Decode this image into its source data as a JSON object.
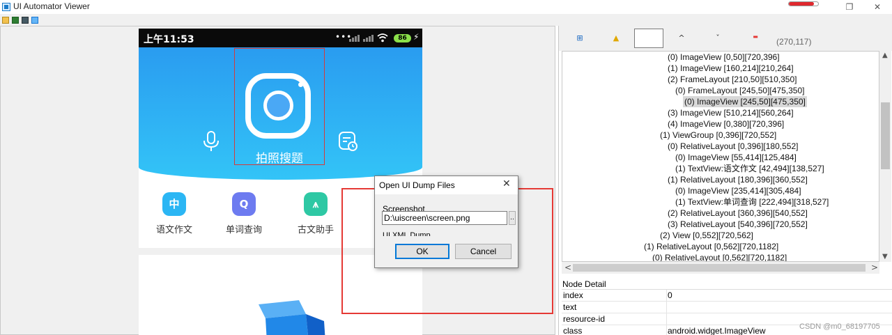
{
  "window": {
    "title": "UI Automator Viewer",
    "minimize_glyph": "—",
    "restore_glyph": "❐",
    "close_glyph": "✕",
    "progress_fraction": 0.85
  },
  "phone": {
    "status_time": "上午11:53",
    "status_dots": "•••",
    "battery": "86",
    "bolt": "⚡",
    "hero_label": "拍照搜题",
    "tools": [
      {
        "label": "语文作文",
        "glyph": "中",
        "color": "#2bb6f4"
      },
      {
        "label": "单词查询",
        "glyph": "Q",
        "color": "#6d7bf0"
      },
      {
        "label": "古文助手",
        "glyph": "⩚",
        "color": "#2ec8a4"
      }
    ]
  },
  "dialog": {
    "title": "Open UI Dump Files",
    "close": "✕",
    "screenshot_label": "Screenshot",
    "screenshot_path": "D:\\uiscreen\\screen.png",
    "browse_label": "..",
    "xml_label": "UI XML Dump",
    "ok_label": "OK",
    "cancel_label": "Cancel"
  },
  "right": {
    "toolbar": {
      "expand": "⊞",
      "warn": "▲",
      "up": "^",
      "down": "ˇ",
      "minus": "▬"
    },
    "coords": "(270,117)",
    "tree": [
      {
        "text": "(0) ImageView [0,50][720,396]",
        "selected": false
      },
      {
        "text": "(1) ImageView [160,214][210,264]",
        "selected": false
      },
      {
        "text": "(2) FrameLayout [210,50][510,350]",
        "selected": false
      },
      {
        "text": "(0) FrameLayout [245,50][475,350]",
        "selected": false
      },
      {
        "text": "(0) ImageView [245,50][475,350]",
        "selected": true
      },
      {
        "text": "(3) ImageView [510,214][560,264]",
        "selected": false
      },
      {
        "text": "(4) ImageView [0,380][720,396]",
        "selected": false
      },
      {
        "text": "(1) ViewGroup [0,396][720,552]",
        "selected": false
      },
      {
        "text": "(0) RelativeLayout [0,396][180,552]",
        "selected": false
      },
      {
        "text": "(0) ImageView [55,414][125,484]",
        "selected": false
      },
      {
        "text": "(1) TextView:语文作文 [42,494][138,527]",
        "selected": false
      },
      {
        "text": "(1) RelativeLayout [180,396][360,552]",
        "selected": false
      },
      {
        "text": "(0) ImageView [235,414][305,484]",
        "selected": false
      },
      {
        "text": "(1) TextView:单词查询 [222,494][318,527]",
        "selected": false
      },
      {
        "text": "(2) RelativeLayout [360,396][540,552]",
        "selected": false
      },
      {
        "text": "(3) RelativeLayout [540,396][720,552]",
        "selected": false
      },
      {
        "text": "(2) View [0,552][720,562]",
        "selected": false
      },
      {
        "text": "(1) RelativeLayout [0,562][720,1182]",
        "selected": false
      },
      {
        "text": "(0) RelativeLayout [0,562][720,1182]",
        "selected": false
      }
    ],
    "scroll_up": "▲",
    "scroll_down": "▼",
    "scroll_left": "<",
    "scroll_right": ">",
    "detail_title": "Node Detail",
    "detail": [
      {
        "key": "index",
        "value": "0"
      },
      {
        "key": "text",
        "value": ""
      },
      {
        "key": "resource-id",
        "value": ""
      },
      {
        "key": "class",
        "value": "android.widget.ImageView"
      }
    ]
  },
  "watermark": "CSDN @m0_68197705"
}
